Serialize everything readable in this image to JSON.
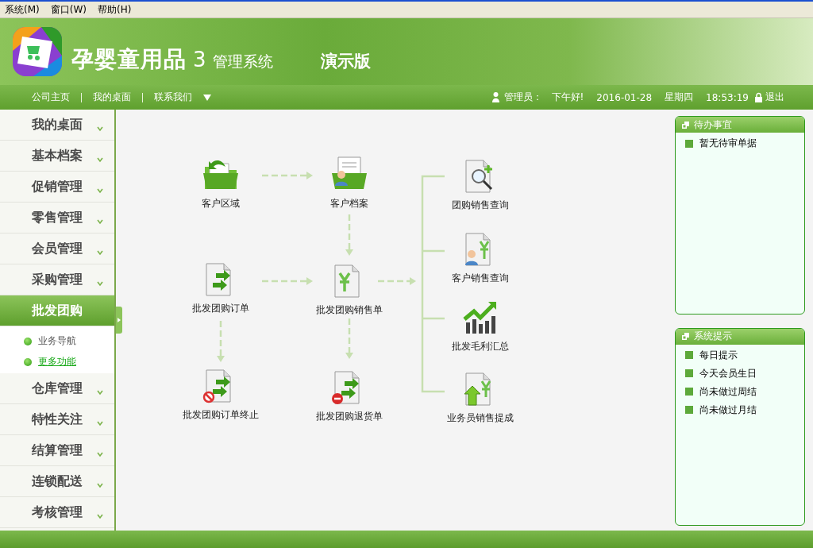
{
  "menu_bar": [
    "系统(M)",
    "窗口(W)",
    "帮助(H)"
  ],
  "header": {
    "product": "孕婴童用品",
    "version": "3",
    "system": "管理系统",
    "edition": "演示版"
  },
  "nav": {
    "links": [
      "公司主页",
      "我的桌面",
      "联系我们"
    ],
    "user_label": "管理员：",
    "greeting": "下午好!",
    "date": "2016-01-28",
    "weekday": "星期四",
    "time": "18:53:19",
    "logout": "退出"
  },
  "sidebar": {
    "items": [
      {
        "label": "我的桌面",
        "selected": false,
        "expanded": false
      },
      {
        "label": "基本档案",
        "selected": false,
        "expanded": false
      },
      {
        "label": "促销管理",
        "selected": false,
        "expanded": false
      },
      {
        "label": "零售管理",
        "selected": false,
        "expanded": false
      },
      {
        "label": "会员管理",
        "selected": false,
        "expanded": false
      },
      {
        "label": "采购管理",
        "selected": false,
        "expanded": false
      },
      {
        "label": "批发团购",
        "selected": true,
        "expanded": true,
        "children": [
          {
            "label": "业务导航",
            "selected": false
          },
          {
            "label": "更多功能",
            "selected": true
          }
        ]
      },
      {
        "label": "仓库管理",
        "selected": false,
        "expanded": false
      },
      {
        "label": "特性关注",
        "selected": false,
        "expanded": false
      },
      {
        "label": "结算管理",
        "selected": false,
        "expanded": false
      },
      {
        "label": "连锁配送",
        "selected": false,
        "expanded": false
      },
      {
        "label": "考核管理",
        "selected": false,
        "expanded": false
      }
    ]
  },
  "flow": {
    "nodes": [
      {
        "label": "客户区域",
        "kind": "folder"
      },
      {
        "label": "客户档案",
        "kind": "person-file"
      },
      {
        "label": "团购销售查询",
        "kind": "search-doc"
      },
      {
        "label": "批发团购订单",
        "kind": "arrow-doc"
      },
      {
        "label": "批发团购销售单",
        "kind": "yen-doc"
      },
      {
        "label": "客户销售查询",
        "kind": "person-doc"
      },
      {
        "label": "批发毛利汇总",
        "kind": "chart"
      },
      {
        "label": "批发团购订单终止",
        "kind": "stop-doc"
      },
      {
        "label": "批发团购退货单",
        "kind": "minus-doc"
      },
      {
        "label": "业务员销售提成",
        "kind": "up-doc"
      }
    ]
  },
  "panels": [
    {
      "title": "待办事宜",
      "items": [
        "暂无待审单据"
      ]
    },
    {
      "title": "系统提示",
      "items": [
        "每日提示",
        "今天会员生日",
        "尚未做过周结",
        "尚未做过月结"
      ]
    }
  ]
}
